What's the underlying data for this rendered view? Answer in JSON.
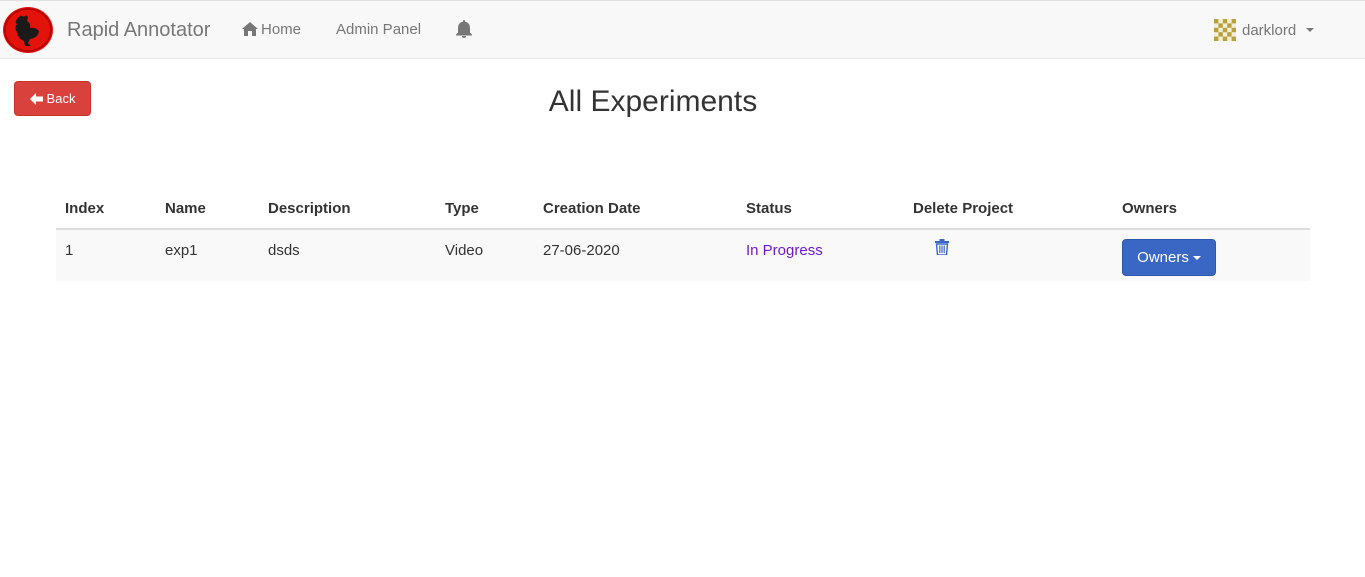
{
  "navbar": {
    "brand": "Rapid Annotator",
    "links": [
      {
        "label": "Home",
        "icon": "home-icon"
      },
      {
        "label": "Admin Panel"
      }
    ],
    "notifications_icon": "bell-icon",
    "user": {
      "name": "darklord",
      "avatar_icon": "identicon-avatar"
    }
  },
  "actions": {
    "back_label": "Back"
  },
  "page": {
    "title": "All Experiments"
  },
  "table": {
    "headers": [
      "Index",
      "Name",
      "Description",
      "Type",
      "Creation Date",
      "Status",
      "Delete Project",
      "Owners"
    ],
    "rows": [
      {
        "index": "1",
        "name": "exp1",
        "description": "dsds",
        "type": "Video",
        "creation_date": "27-06-2020",
        "status": "In Progress",
        "delete_icon": "trash-icon",
        "owners_label": "Owners"
      }
    ]
  },
  "colors": {
    "danger": "#d9413d",
    "primary": "#3a67c4",
    "status_in_progress": "#6f18d9",
    "navbar_bg": "#f8f8f8"
  }
}
